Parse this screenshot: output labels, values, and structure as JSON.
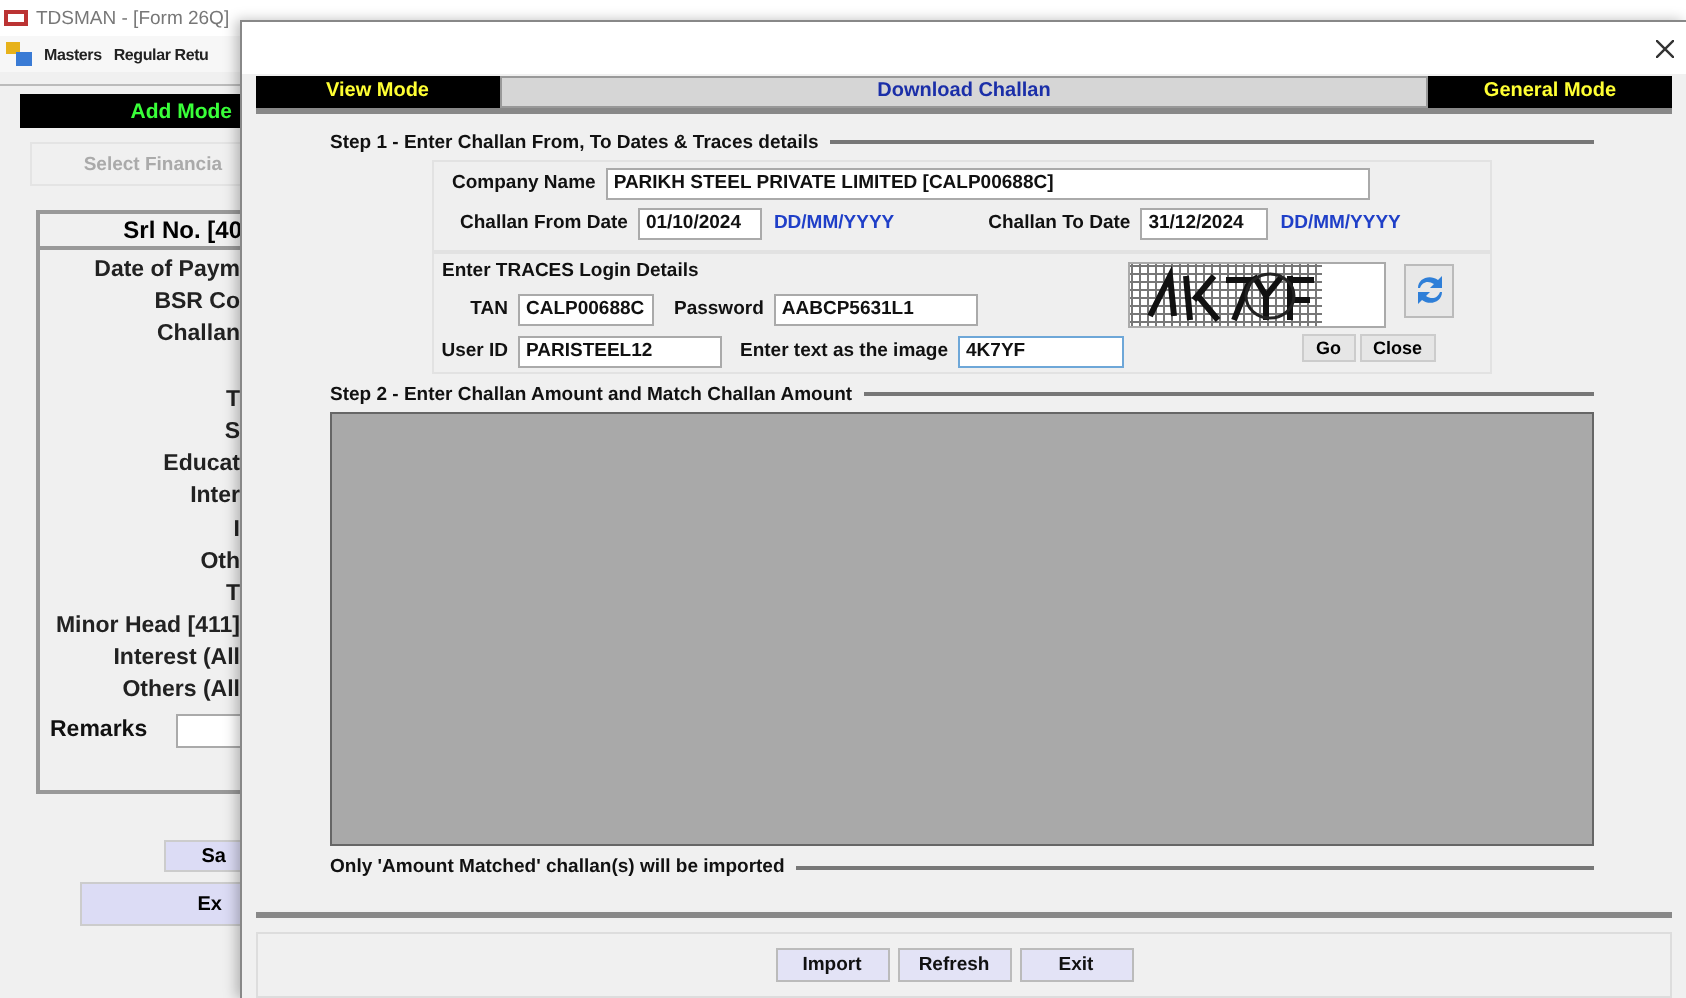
{
  "app": {
    "title": "TDSMAN - [Form 26Q]",
    "menu": [
      "Masters",
      "Regular Retu"
    ],
    "mode": "Add Mode",
    "year_button": "Select Financia",
    "srl_header": "Srl No. [40",
    "fields": [
      "Date of Paym",
      "BSR Co",
      "Challan",
      "T",
      "S",
      "Educat",
      "Inter",
      "I",
      "Oth",
      "T",
      "Minor Head [411]",
      "Interest (All",
      "Others (All"
    ],
    "remarks_label": "Remarks",
    "buttons": [
      "Sa",
      "Ex"
    ]
  },
  "dialog": {
    "modes": [
      {
        "label": "View Mode",
        "kind": "mode"
      },
      {
        "label": "Download Challan",
        "kind": "title"
      },
      {
        "label": "General Mode",
        "kind": "mode"
      }
    ],
    "step1": {
      "title": "Step 1 - Enter Challan From, To Dates & Traces details",
      "company": {
        "label": "Company Name",
        "value": "PARIKH STEEL PRIVATE LIMITED [CALP00688C]"
      },
      "from": {
        "label": "Challan From Date",
        "value": "01/10/2024",
        "format": "DD/MM/YYYY"
      },
      "to": {
        "label": "Challan To Date",
        "value": "31/12/2024",
        "format": "DD/MM/YYYY"
      },
      "login_title": "Enter TRACES Login Details",
      "tan": {
        "label": "TAN",
        "value": "CALP00688C"
      },
      "password": {
        "label": "Password",
        "value": "AABCP5631L1"
      },
      "user_id": {
        "label": "User ID",
        "value": "PARISTEEL12"
      },
      "captcha": {
        "label": "Enter text as the image",
        "value": "4K7YF"
      },
      "buttons": [
        "Go",
        "Close"
      ]
    },
    "step2": {
      "title": "Step 2 - Enter Challan Amount and Match Challan Amount"
    },
    "note": "Only 'Amount Matched' challan(s) will be imported",
    "buttons": [
      "Import",
      "Refresh",
      "Exit"
    ]
  }
}
